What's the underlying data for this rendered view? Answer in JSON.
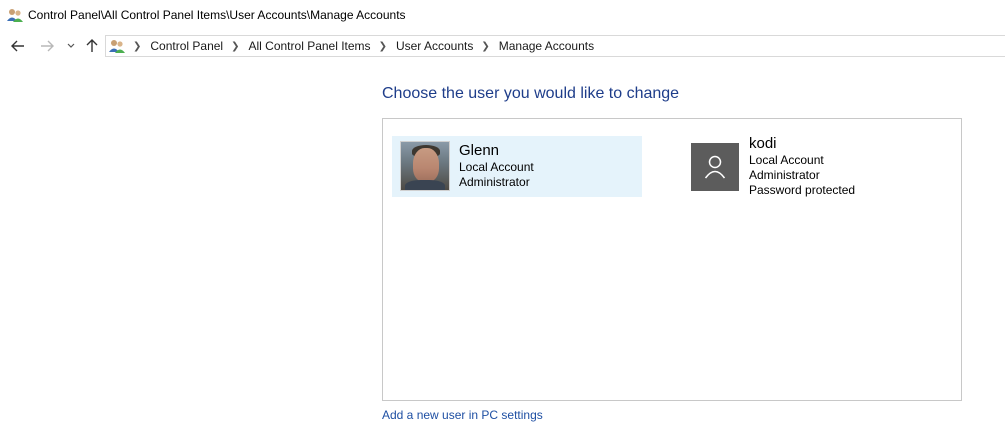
{
  "window": {
    "title": "Control Panel\\All Control Panel Items\\User Accounts\\Manage Accounts",
    "icon": "user-accounts-icon"
  },
  "navigation": {
    "back": "back-arrow-icon",
    "forward": "forward-arrow-icon",
    "recent": "chevron-down-icon",
    "up": "up-arrow-icon",
    "breadcrumbs": [
      "Control Panel",
      "All Control Panel Items",
      "User Accounts",
      "Manage Accounts"
    ]
  },
  "main": {
    "heading": "Choose the user you would like to change",
    "accounts": [
      {
        "name": "Glenn",
        "lines": [
          "Local Account",
          "Administrator"
        ],
        "picture": "user-photo",
        "selected": true
      },
      {
        "name": "kodi",
        "lines": [
          "Local Account",
          "Administrator",
          "Password protected"
        ],
        "picture": "default-user-icon",
        "selected": false
      }
    ],
    "add_user_link": "Add a new user in PC settings"
  },
  "colors": {
    "heading": "#1e3d8a",
    "link": "#1e4fa3",
    "selected_bg": "#e5f3fb",
    "default_avatar_bg": "#5c5c5c"
  }
}
